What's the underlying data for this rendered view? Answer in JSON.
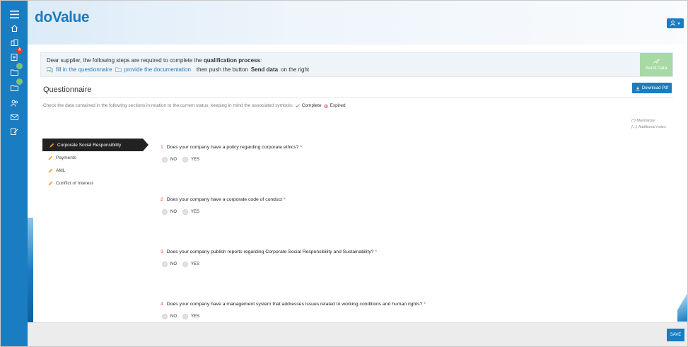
{
  "app": {
    "logo": "doValue"
  },
  "sidebar": {
    "items": [
      {
        "icon": "menu-icon"
      },
      {
        "icon": "home-icon"
      },
      {
        "icon": "buildings-icon"
      },
      {
        "icon": "clipboard-icon",
        "badge": "4",
        "badge_color": "#e53935"
      },
      {
        "icon": "folder-icon",
        "badge": "",
        "badge_color": "#7cc576"
      },
      {
        "icon": "folder-icon",
        "badge": "",
        "badge_color": "#7cc576"
      },
      {
        "icon": "users-icon"
      },
      {
        "icon": "mail-icon"
      },
      {
        "icon": "edit-document-icon"
      }
    ]
  },
  "notice": {
    "line1_prefix": "Dear supplier, the following steps are required to complete the ",
    "line1_bold": "qualification process",
    "line1_suffix": ":",
    "step1": "fill in the questionnaire",
    "step2": "provide the documentation",
    "line2_mid": "then push the button",
    "line2_bold": "Send data",
    "line2_suffix": "on the right",
    "send_data": "Send Data"
  },
  "questionnaire": {
    "title": "Questionnaire",
    "download": "Download Pdf",
    "check_text": "Check the data contained in the following sections in relation to the current status, keeping in mind the associated symbols:",
    "complete": "Complete",
    "expired": "Expired",
    "legend_mandatory": "(*) Mandatory",
    "legend_notes": "(...) Additional notes"
  },
  "sections": [
    {
      "label": "Corporate Social Responsibility",
      "active": true
    },
    {
      "label": "Payments",
      "active": false
    },
    {
      "label": "AML",
      "active": false
    },
    {
      "label": "Conflict of Interest",
      "active": false
    }
  ],
  "questions": [
    {
      "num": "1",
      "text": "Does your company have a policy regarding corporate ethics?",
      "req": "*",
      "no": "NO",
      "yes": "YES"
    },
    {
      "num": "2",
      "text": "Does your company have a corporate code of conduct",
      "req": "*",
      "no": "NO",
      "yes": "YES"
    },
    {
      "num": "3",
      "text": "Does your company publish reports regarding Corporate Social Responsibility and Sustainability?",
      "req": "*",
      "no": "NO",
      "yes": "YES"
    },
    {
      "num": "4",
      "text": "Does your company have a management system that addresses issues related to working conditions and human rights?",
      "req": "*",
      "no": "NO",
      "yes": "YES"
    }
  ],
  "footer": {
    "save": "SAVE"
  },
  "colors": {
    "brand": "#1a7cc1",
    "send_disabled": "#a6d9a4",
    "required": "#d9302c"
  }
}
